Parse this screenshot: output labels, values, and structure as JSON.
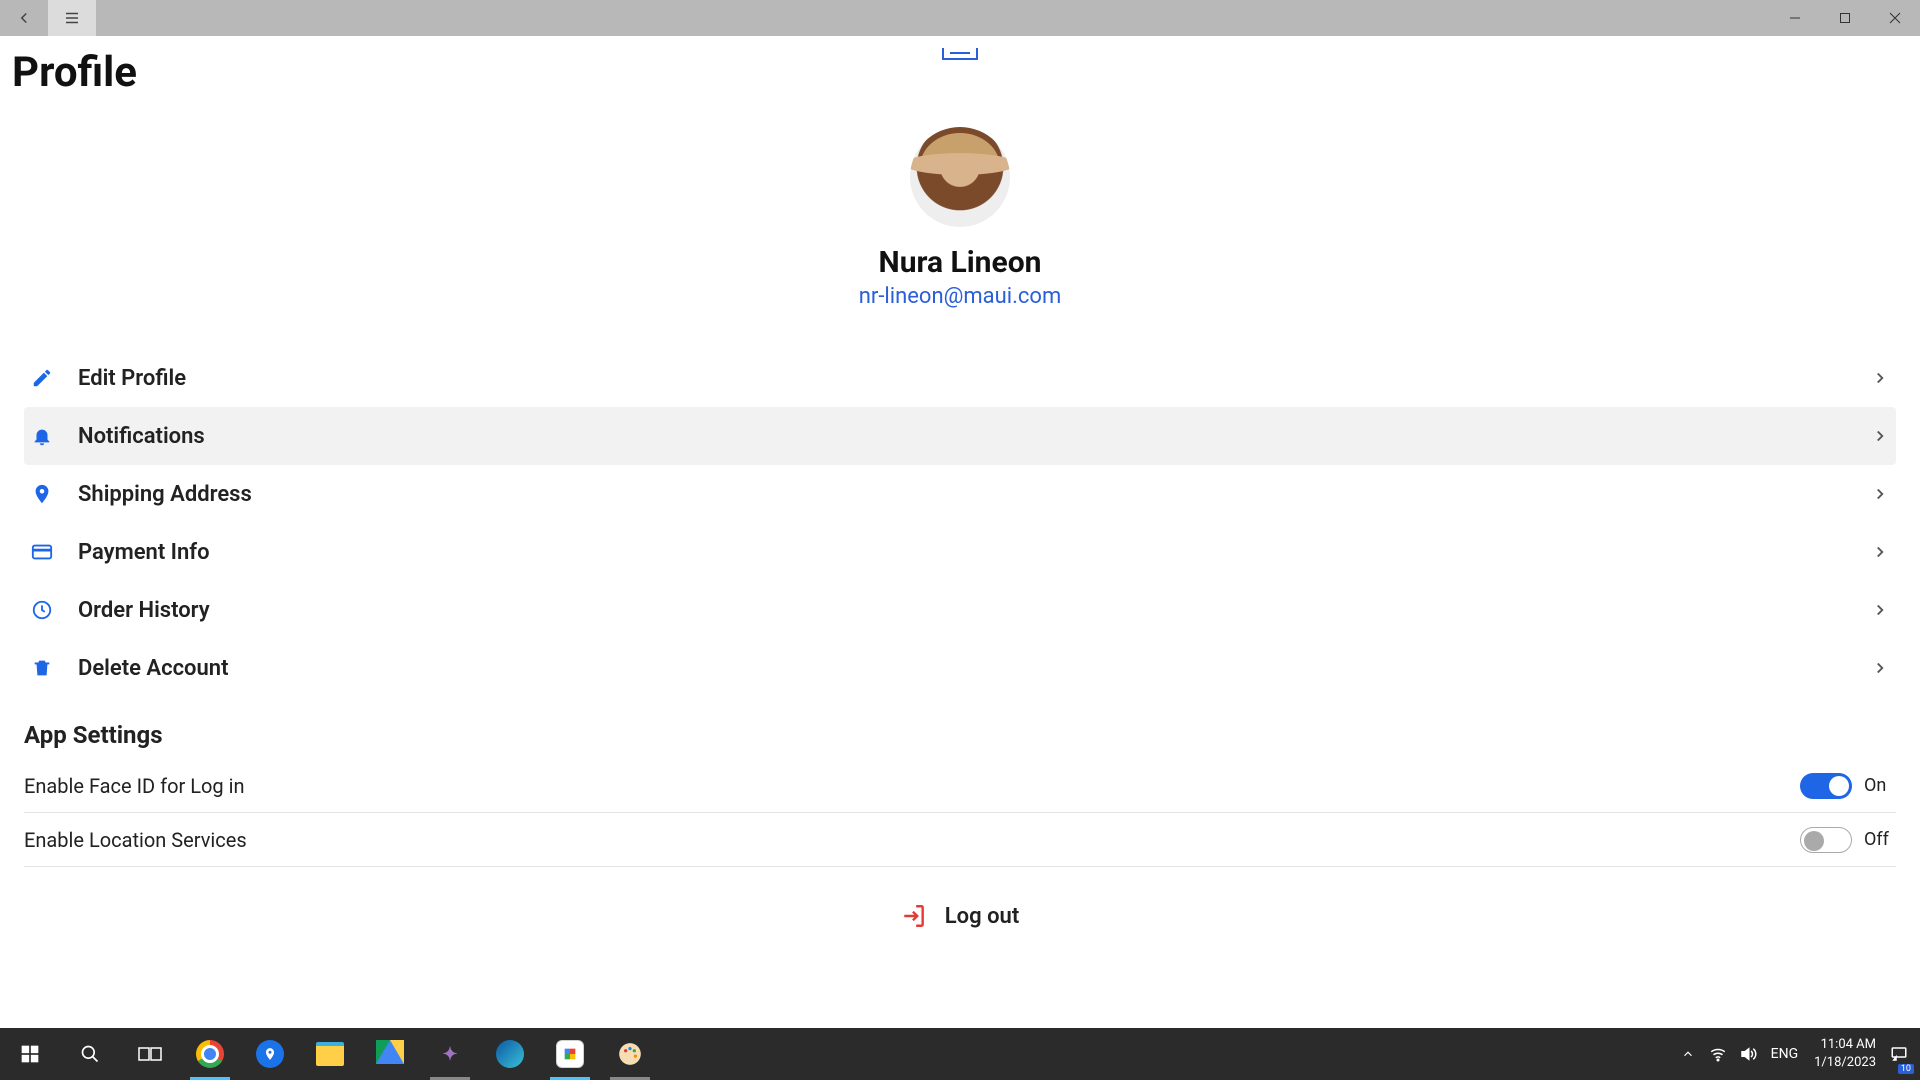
{
  "page": {
    "title": "Profile"
  },
  "profile": {
    "name": "Nura Lineon",
    "email": "nr-lineon@maui.com"
  },
  "menu": {
    "items": [
      {
        "icon": "pencil-icon",
        "label": "Edit Profile",
        "highlight": false
      },
      {
        "icon": "bell-icon",
        "label": "Notifications",
        "highlight": true
      },
      {
        "icon": "location-icon",
        "label": "Shipping Address",
        "highlight": false
      },
      {
        "icon": "card-icon",
        "label": "Payment Info",
        "highlight": false
      },
      {
        "icon": "clock-icon",
        "label": "Order History",
        "highlight": false
      },
      {
        "icon": "trash-icon",
        "label": "Delete Account",
        "highlight": false
      }
    ]
  },
  "settings": {
    "header": "App Settings",
    "items": [
      {
        "label": "Enable Face ID for Log in",
        "on": true,
        "state_label": "On"
      },
      {
        "label": "Enable Location Services",
        "on": false,
        "state_label": "Off"
      }
    ]
  },
  "logout": {
    "label": "Log out"
  },
  "taskbar": {
    "tray": {
      "language": "ENG",
      "time": "11:04 AM",
      "date": "1/18/2023",
      "badge": "10"
    }
  }
}
